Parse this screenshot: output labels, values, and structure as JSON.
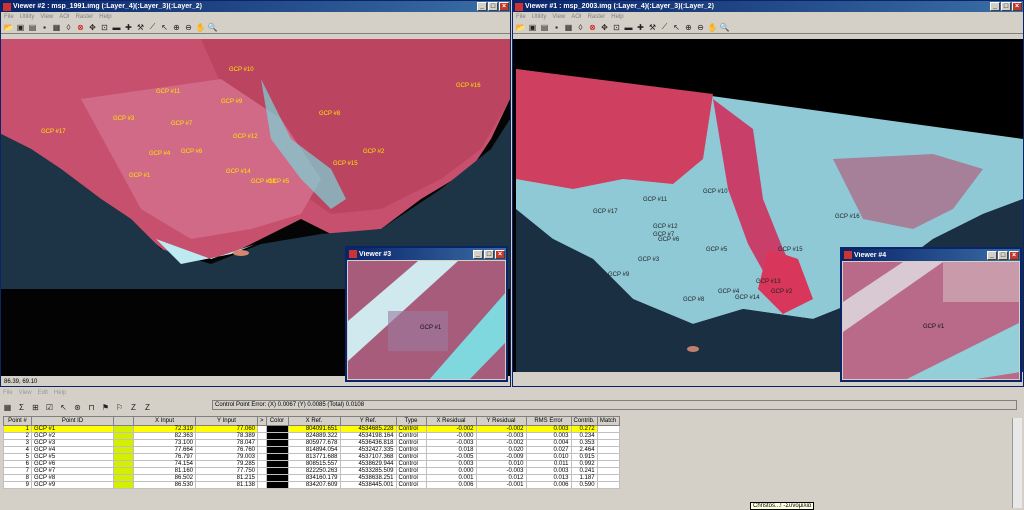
{
  "viewer2": {
    "title": "Viewer #2 : msp_1991.img (:Layer_4)(:Layer_3)(:Layer_2)",
    "status": "86.39, 69.10",
    "gcps": [
      "GCP #10",
      "GCP #11",
      "GCP #9",
      "GCP #16",
      "GCP #8",
      "GCP #7",
      "GCP #3",
      "GCP #12",
      "GCP #4",
      "GCP #2",
      "GCP #14",
      "GCP #5",
      "GCP #1",
      "GCP #15",
      "GCP #13",
      "GCP #17",
      "GCP #6"
    ]
  },
  "viewer1": {
    "title": "Viewer #1 : msp_2003.img (:Layer_4)(:Layer_3)(:Layer_2)",
    "gcps": [
      "GCP #11",
      "GCP #10",
      "GCP #17",
      "GCP #12",
      "GCP #16",
      "GCP #7",
      "GCP #6",
      "GCP #5",
      "GCP #3",
      "GCP #15",
      "GCP #13",
      "GCP #9",
      "GCP #4",
      "GCP #14",
      "GCP #2",
      "GCP #8"
    ]
  },
  "menu": [
    "File",
    "Utility",
    "View",
    "AOI",
    "Raster",
    "Help"
  ],
  "viewer3": {
    "title": "Viewer #3",
    "gcp": "GCP #1"
  },
  "viewer4": {
    "title": "Viewer #4",
    "gcp": "GCP #1"
  },
  "editor": {
    "menu": [
      "File",
      "View",
      "Edit",
      "Help"
    ],
    "cpe": "Control Point Error: (X) 0.0067    (Y) 0.0085    (Total) 0.0108",
    "headers": [
      "Point #",
      "Point ID",
      "",
      "X Input",
      "Y Input",
      ">",
      "Color",
      "X Ref.",
      "Y Ref.",
      "Type",
      "X Residual",
      "Y Residual",
      "RMS Error",
      "Contrib.",
      "Match"
    ],
    "rows": [
      [
        "1",
        "GCP #1",
        "72.319",
        "77.060",
        "804091.651",
        "4534685.228",
        "Control",
        "-0.002",
        "-0.002",
        "0.003",
        "0.272",
        ""
      ],
      [
        "2",
        "GCP #2",
        "82.363",
        "78.389",
        "824889.322",
        "4534198.164",
        "Control",
        "-0.000",
        "-0.003",
        "0.003",
        "0.234",
        ""
      ],
      [
        "3",
        "GCP #3",
        "73.100",
        "78.047",
        "805977.678",
        "4536436.818",
        "Control",
        "-0.003",
        "-0.002",
        "0.004",
        "0.353",
        ""
      ],
      [
        "4",
        "GCP #4",
        "77.664",
        "76.760",
        "814894.054",
        "4532427.335",
        "Control",
        "0.018",
        "0.020",
        "0.027",
        "2.464",
        ""
      ],
      [
        "5",
        "GCP #5",
        "76.797",
        "79.003",
        "813771.688",
        "4537107.368",
        "Control",
        "-0.005",
        "-0.009",
        "0.010",
        "0.915",
        ""
      ],
      [
        "6",
        "GCP #6",
        "74.154",
        "79.285",
        "808515.557",
        "4538629.944",
        "Control",
        "0.003",
        "0.010",
        "0.011",
        "0.992",
        ""
      ],
      [
        "7",
        "GCP #7",
        "81.160",
        "77.750",
        "822250.263",
        "4533285.509",
        "Control",
        "0.000",
        "-0.003",
        "0.003",
        "0.241",
        ""
      ],
      [
        "8",
        "GCP #8",
        "86.502",
        "81.215",
        "834160.179",
        "4538638.251",
        "Control",
        "0.001",
        "0.012",
        "0.013",
        "1.187",
        ""
      ],
      [
        "9",
        "GCP #9",
        "86.530",
        "81.138",
        "834207.609",
        "4538445.001",
        "Control",
        "0.006",
        "-0.001",
        "0.006",
        "0.590",
        ""
      ]
    ],
    "tooltip": "Christos...! -Συνομιλία"
  }
}
